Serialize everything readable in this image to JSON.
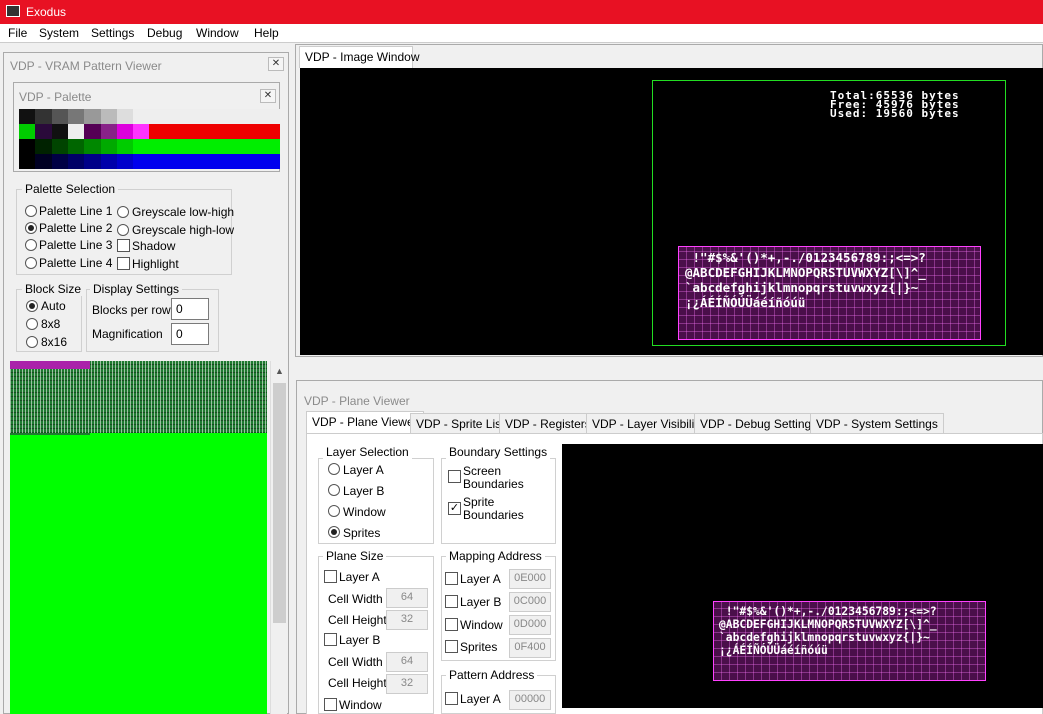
{
  "app": {
    "title": "Exodus"
  },
  "menu": [
    "File",
    "System",
    "Settings",
    "Debug",
    "Window",
    "Help"
  ],
  "vram": {
    "title": "VDP - VRAM Pattern Viewer",
    "palette": {
      "title": "VDP - Palette",
      "rows": [
        [
          "#111111",
          "#333333",
          "#555555",
          "#777777",
          "#999999",
          "#bbbbbb",
          "#dddddd",
          "#eeeeee",
          "#eeeeee",
          "#eeeeee",
          "#eeeeee",
          "#eeeeee",
          "#eeeeee",
          "#eeeeee",
          "#eeeeee",
          "#eeeeee"
        ],
        [
          "#00cc00",
          "#2a0a3a",
          "#111111",
          "#eeeeee",
          "#550055",
          "#882288",
          "#dd00dd",
          "#ff33ff",
          "#ee0000",
          "#ee0000",
          "#ee0000",
          "#ee0000",
          "#ee0000",
          "#ee0000",
          "#ee0000",
          "#ee0000"
        ],
        [
          "#000000",
          "#002200",
          "#004400",
          "#006600",
          "#008800",
          "#00aa00",
          "#00cc00",
          "#00ee00",
          "#00ee00",
          "#00ee00",
          "#00ee00",
          "#00ee00",
          "#00ee00",
          "#00ee00",
          "#00ee00",
          "#00ee00"
        ],
        [
          "#000000",
          "#000022",
          "#000044",
          "#000066",
          "#000088",
          "#0000aa",
          "#0000cc",
          "#0000ee",
          "#0000ee",
          "#0000ee",
          "#0000ee",
          "#0000ee",
          "#0000ee",
          "#0000ee",
          "#0000ee",
          "#0000ee"
        ]
      ]
    },
    "palette_selection": {
      "label": "Palette Selection",
      "options": [
        "Palette Line 1",
        "Palette Line 2",
        "Palette Line 3",
        "Palette Line 4"
      ],
      "selected": "Palette Line 2",
      "greyscale_low_high": "Greyscale low-high",
      "greyscale_high_low": "Greyscale high-low",
      "shadow": "Shadow",
      "highlight": "Highlight"
    },
    "block_size": {
      "label": "Block Size",
      "options": [
        "Auto",
        "8x8",
        "8x16"
      ],
      "selected": "Auto"
    },
    "display_settings": {
      "label": "Display Settings",
      "blocks_per_row_label": "Blocks per row",
      "blocks_per_row": "0",
      "magnification_label": "Magnification",
      "magnification": "0"
    }
  },
  "image_window": {
    "tab": "VDP - Image Window",
    "stats": "Total:65536 bytes\nFree: 45976 bytes\nUsed: 19560 bytes",
    "charset": [
      " !\"#$%&'()*+,-./0123456789:;<=>?",
      "@ABCDEFGHIJKLMNOPQRSTUVWXYZ[\\]^_",
      "`abcdefghijklmnopqrstuvwxyz{|}~",
      "¡¿ÁÉÍÑÓÚÜáéíñóúü"
    ]
  },
  "plane_viewer": {
    "title": "VDP - Plane Viewer",
    "tabs": [
      "VDP - Plane Viewer",
      "VDP - Sprite List",
      "VDP - Registers",
      "VDP - Layer Visibility",
      "VDP - Debug Settings",
      "VDP - System Settings"
    ],
    "layer_selection": {
      "label": "Layer Selection",
      "options": [
        "Layer A",
        "Layer B",
        "Window",
        "Sprites"
      ],
      "selected": "Sprites"
    },
    "boundary": {
      "label": "Boundary Settings",
      "screen": "Screen Boundaries",
      "sprite": "Sprite Boundaries",
      "screen_checked": false,
      "sprite_checked": true
    },
    "plane_size": {
      "label": "Plane Size",
      "layer_a": "Layer A",
      "layer_b": "Layer B",
      "window": "Window",
      "cell_width": "Cell Width",
      "cell_height": "Cell Height",
      "a_width": "64",
      "a_height": "32",
      "b_width": "64",
      "b_height": "32"
    },
    "mapping": {
      "label": "Mapping Address",
      "rows": [
        {
          "name": "Layer A",
          "value": "0E000"
        },
        {
          "name": "Layer B",
          "value": "0C000"
        },
        {
          "name": "Window",
          "value": "0D000"
        },
        {
          "name": "Sprites",
          "value": "0F400"
        }
      ]
    },
    "pattern": {
      "label": "Pattern Address",
      "layer_a": "Layer A",
      "layer_a_value": "00000"
    }
  },
  "colors": {
    "titlebar": "#e81123",
    "vram_green": "#00ff00",
    "sprite_bg": "#4a0f4a",
    "sprite_border": "#ff40ff"
  }
}
